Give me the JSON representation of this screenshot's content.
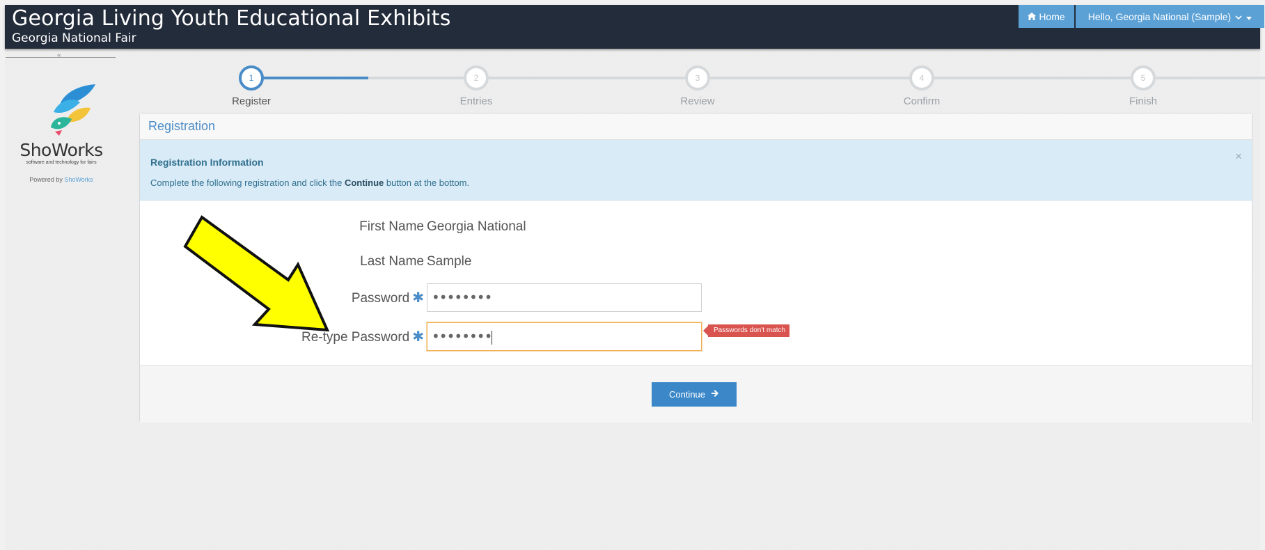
{
  "header": {
    "title": "Georgia Living Youth Educational Exhibits",
    "subtitle": "Georgia National Fair",
    "home_label": "Home",
    "user_label": "Hello, Georgia National (Sample)"
  },
  "sidebar": {
    "collapse_glyph": "«",
    "brand": "ShoWorks",
    "tagline": "software and technology for fairs",
    "powered_prefix": "Powered by ",
    "powered_link": "ShoWorks"
  },
  "stepper": {
    "steps": [
      {
        "number": "1",
        "label": "Register",
        "active": true
      },
      {
        "number": "2",
        "label": "Entries",
        "active": false
      },
      {
        "number": "3",
        "label": "Review",
        "active": false
      },
      {
        "number": "4",
        "label": "Confirm",
        "active": false
      },
      {
        "number": "5",
        "label": "Finish",
        "active": false
      }
    ]
  },
  "panel": {
    "heading": "Registration",
    "info_title": "Registration Information",
    "info_text_before": "Complete the following registration and click the ",
    "info_text_bold": "Continue",
    "info_text_after": " button at the bottom.",
    "close_glyph": "×"
  },
  "form": {
    "first_name_label": "First Name",
    "first_name_value": "Georgia National",
    "last_name_label": "Last Name",
    "last_name_value": "Sample",
    "password_label": "Password",
    "password_value": "••••••••",
    "retype_label": "Re-type Password",
    "retype_value": "••••••••",
    "required_glyph": "✱",
    "error_text": "Passwords don't match"
  },
  "footer": {
    "continue_label": "Continue"
  },
  "colors": {
    "header_bg": "#232c3b",
    "accent": "#4a8cc7",
    "nav_bg": "#5ba1d6",
    "error": "#d9534f",
    "annotation_arrow": "#ffff00"
  }
}
